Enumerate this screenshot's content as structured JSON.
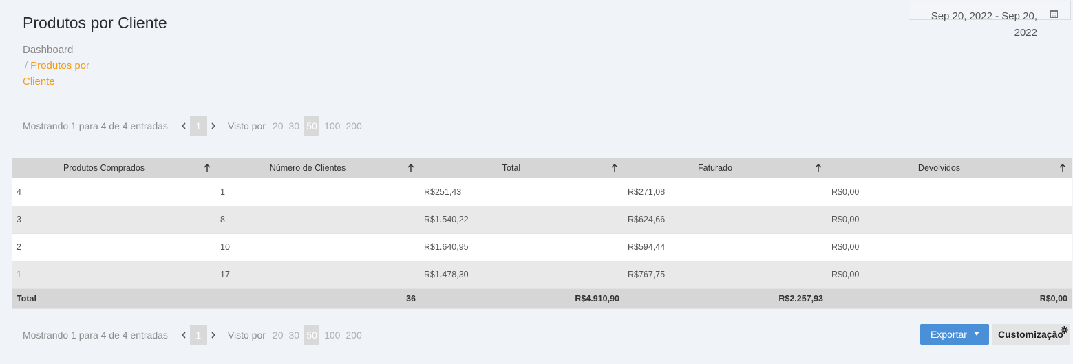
{
  "header": {
    "title": "Produtos por Cliente",
    "breadcrumb": {
      "home": "Dashboard",
      "separator": "/",
      "current_line1": "Produtos por",
      "current_line2": "Cliente"
    }
  },
  "date_range": {
    "line1": "Sep 20, 2022 - Sep 20,",
    "line2": "2022",
    "icon": "calendar-icon"
  },
  "pagination_top": {
    "info": "Mostrando 1 para 4 de 4 entradas",
    "page": "1",
    "per_label": "Visto por",
    "per_options": [
      "20",
      "30",
      "50",
      "100",
      "200"
    ],
    "per_selected": "50"
  },
  "pagination_bottom": {
    "info": "Mostrando 1 para 4 de 4 entradas",
    "page": "1",
    "per_label": "Visto por",
    "per_options": [
      "20",
      "30",
      "50",
      "100",
      "200"
    ],
    "per_selected": "50"
  },
  "table": {
    "columns": [
      "Produtos Comprados",
      "Número de Clientes",
      "Total",
      "Faturado",
      "Devolvidos"
    ],
    "rows": [
      [
        "4",
        "1",
        "R$251,43",
        "R$271,08",
        "R$0,00"
      ],
      [
        "3",
        "8",
        "R$1.540,22",
        "R$624,66",
        "R$0,00"
      ],
      [
        "2",
        "10",
        "R$1.640,95",
        "R$594,44",
        "R$0,00"
      ],
      [
        "1",
        "17",
        "R$1.478,30",
        "R$767,75",
        "R$0,00"
      ]
    ],
    "footer": [
      "Total",
      "36",
      "R$4.910,90",
      "R$2.257,93",
      "R$0,00"
    ]
  },
  "actions": {
    "export_label": "Exportar",
    "customize_label": "Customização"
  },
  "colors": {
    "accent": "#f39c12",
    "button_primary": "#4a90d9",
    "header_bg": "#d6d6d6"
  }
}
